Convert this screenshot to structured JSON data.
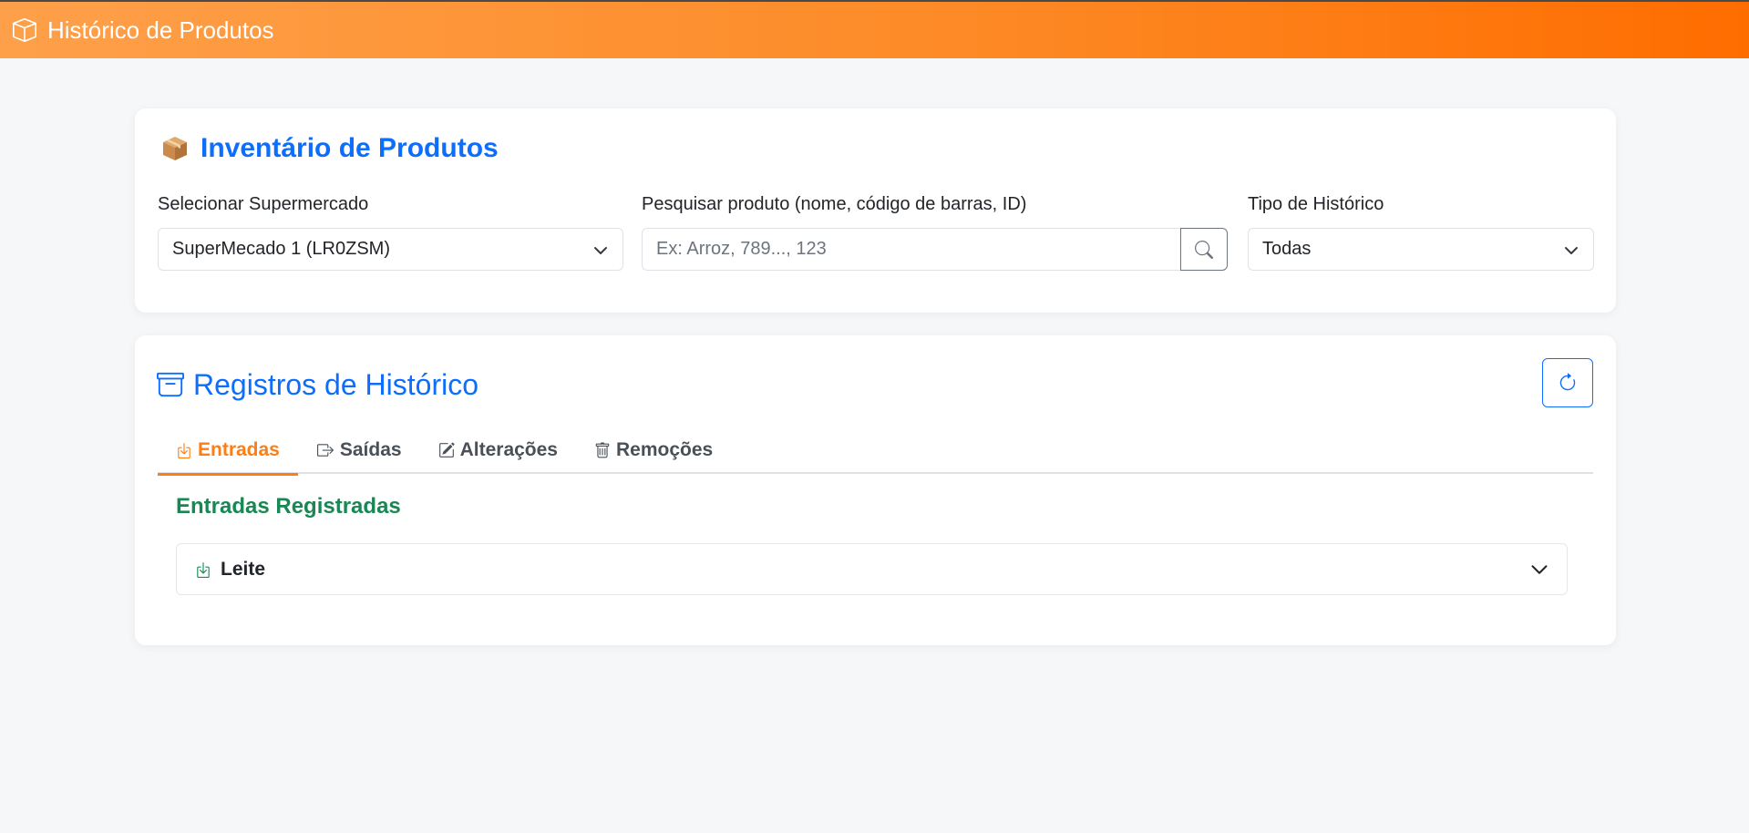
{
  "header": {
    "title": "Histórico de Produtos",
    "icon": "box-icon",
    "gradient": [
      "#fea04a",
      "#fe6d00"
    ]
  },
  "inventory": {
    "title": "Inventário de Produtos",
    "icon": "package-emoji",
    "supermarket_label": "Selecionar Supermercado",
    "supermarket_value": "SuperMecado 1 (LR0ZSM)",
    "search_label": "Pesquisar produto (nome, código de barras, ID)",
    "search_placeholder": "Ex: Arroz, 789..., 123",
    "search_value": "",
    "history_type_label": "Tipo de Histórico",
    "history_type_value": "Todas"
  },
  "records": {
    "title": "Registros de Histórico",
    "icon": "archive-icon",
    "refresh_icon": "refresh-icon",
    "tabs": [
      {
        "label": "Entradas",
        "icon": "box-arrow-in-down-icon",
        "active": true
      },
      {
        "label": "Saídas",
        "icon": "box-arrow-right-icon",
        "active": false
      },
      {
        "label": "Alterações",
        "icon": "pencil-square-icon",
        "active": false
      },
      {
        "label": "Remoções",
        "icon": "trash-icon",
        "active": false
      }
    ],
    "section_title": "Entradas Registradas",
    "items": [
      {
        "label": "Leite",
        "icon": "box-arrow-in-down-icon",
        "expanded": false
      }
    ]
  },
  "colors": {
    "primary": "#0d6efd",
    "accent": "#fd7e14",
    "success": "#198754"
  }
}
